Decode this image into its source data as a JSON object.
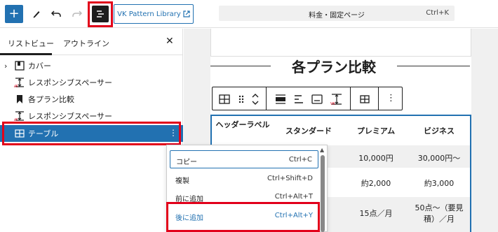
{
  "toolbar": {
    "vk_label": "VK Pattern Library",
    "command_title": "料金・固定ページ",
    "command_shortcut": "Ctrl+K"
  },
  "sidebar": {
    "tabs": [
      "リストビュー",
      "アウトライン"
    ],
    "close": "✕",
    "items": [
      {
        "label": "カバー",
        "icon": "cover-icon"
      },
      {
        "label": "レスポンシブスペーサー",
        "icon": "spacer-icon"
      },
      {
        "label": "各プラン比較",
        "icon": "bookmark-icon"
      },
      {
        "label": "レスポンシブスペーサー",
        "icon": "spacer-icon"
      },
      {
        "label": "テーブル",
        "icon": "table-icon",
        "selected": true
      }
    ]
  },
  "canvas": {
    "heading": "各プラン比較",
    "table": {
      "headers": [
        "ヘッダーラベル",
        "スタンダード",
        "プレミアム",
        "ビジネス"
      ],
      "rows": [
        [
          "",
          "",
          "10,000円",
          "30,000円〜"
        ],
        [
          "",
          "",
          "約2,000",
          "約3,000"
        ],
        [
          "",
          "",
          "15点／月",
          "50点〜（要見積）／月"
        ]
      ]
    }
  },
  "menu": {
    "items": [
      {
        "label": "コピー",
        "shortcut": "Ctrl+C"
      },
      {
        "label": "複製",
        "shortcut": "Ctrl+Shift+D"
      },
      {
        "label": "前に追加",
        "shortcut": "Ctrl+Alt+T"
      },
      {
        "label": "後に追加",
        "shortcut": "Ctrl+Alt+Y"
      }
    ]
  },
  "colors": {
    "accent": "#2271b1",
    "highlight": "#e2001a"
  }
}
